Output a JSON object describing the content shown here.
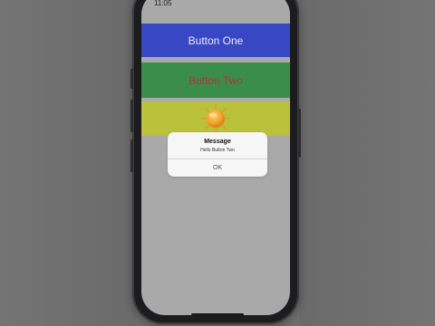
{
  "status_bar": {
    "time": "11:05"
  },
  "rows": {
    "one": {
      "label": "Button One",
      "color": "#3847c4",
      "text_color": "#ececf6"
    },
    "two": {
      "label": "Button Two",
      "color": "#3b8d4a",
      "text_color": "#b3323c"
    },
    "three": {
      "icon": "sun-icon",
      "color": "#b9c23a"
    }
  },
  "alert": {
    "title": "Message",
    "message": "Hello Button Two",
    "ok_label": "OK"
  },
  "colors": {
    "background": "#6e6e6e",
    "screen": "#a9a9a9",
    "phone_frame": "#1c1c1e"
  }
}
